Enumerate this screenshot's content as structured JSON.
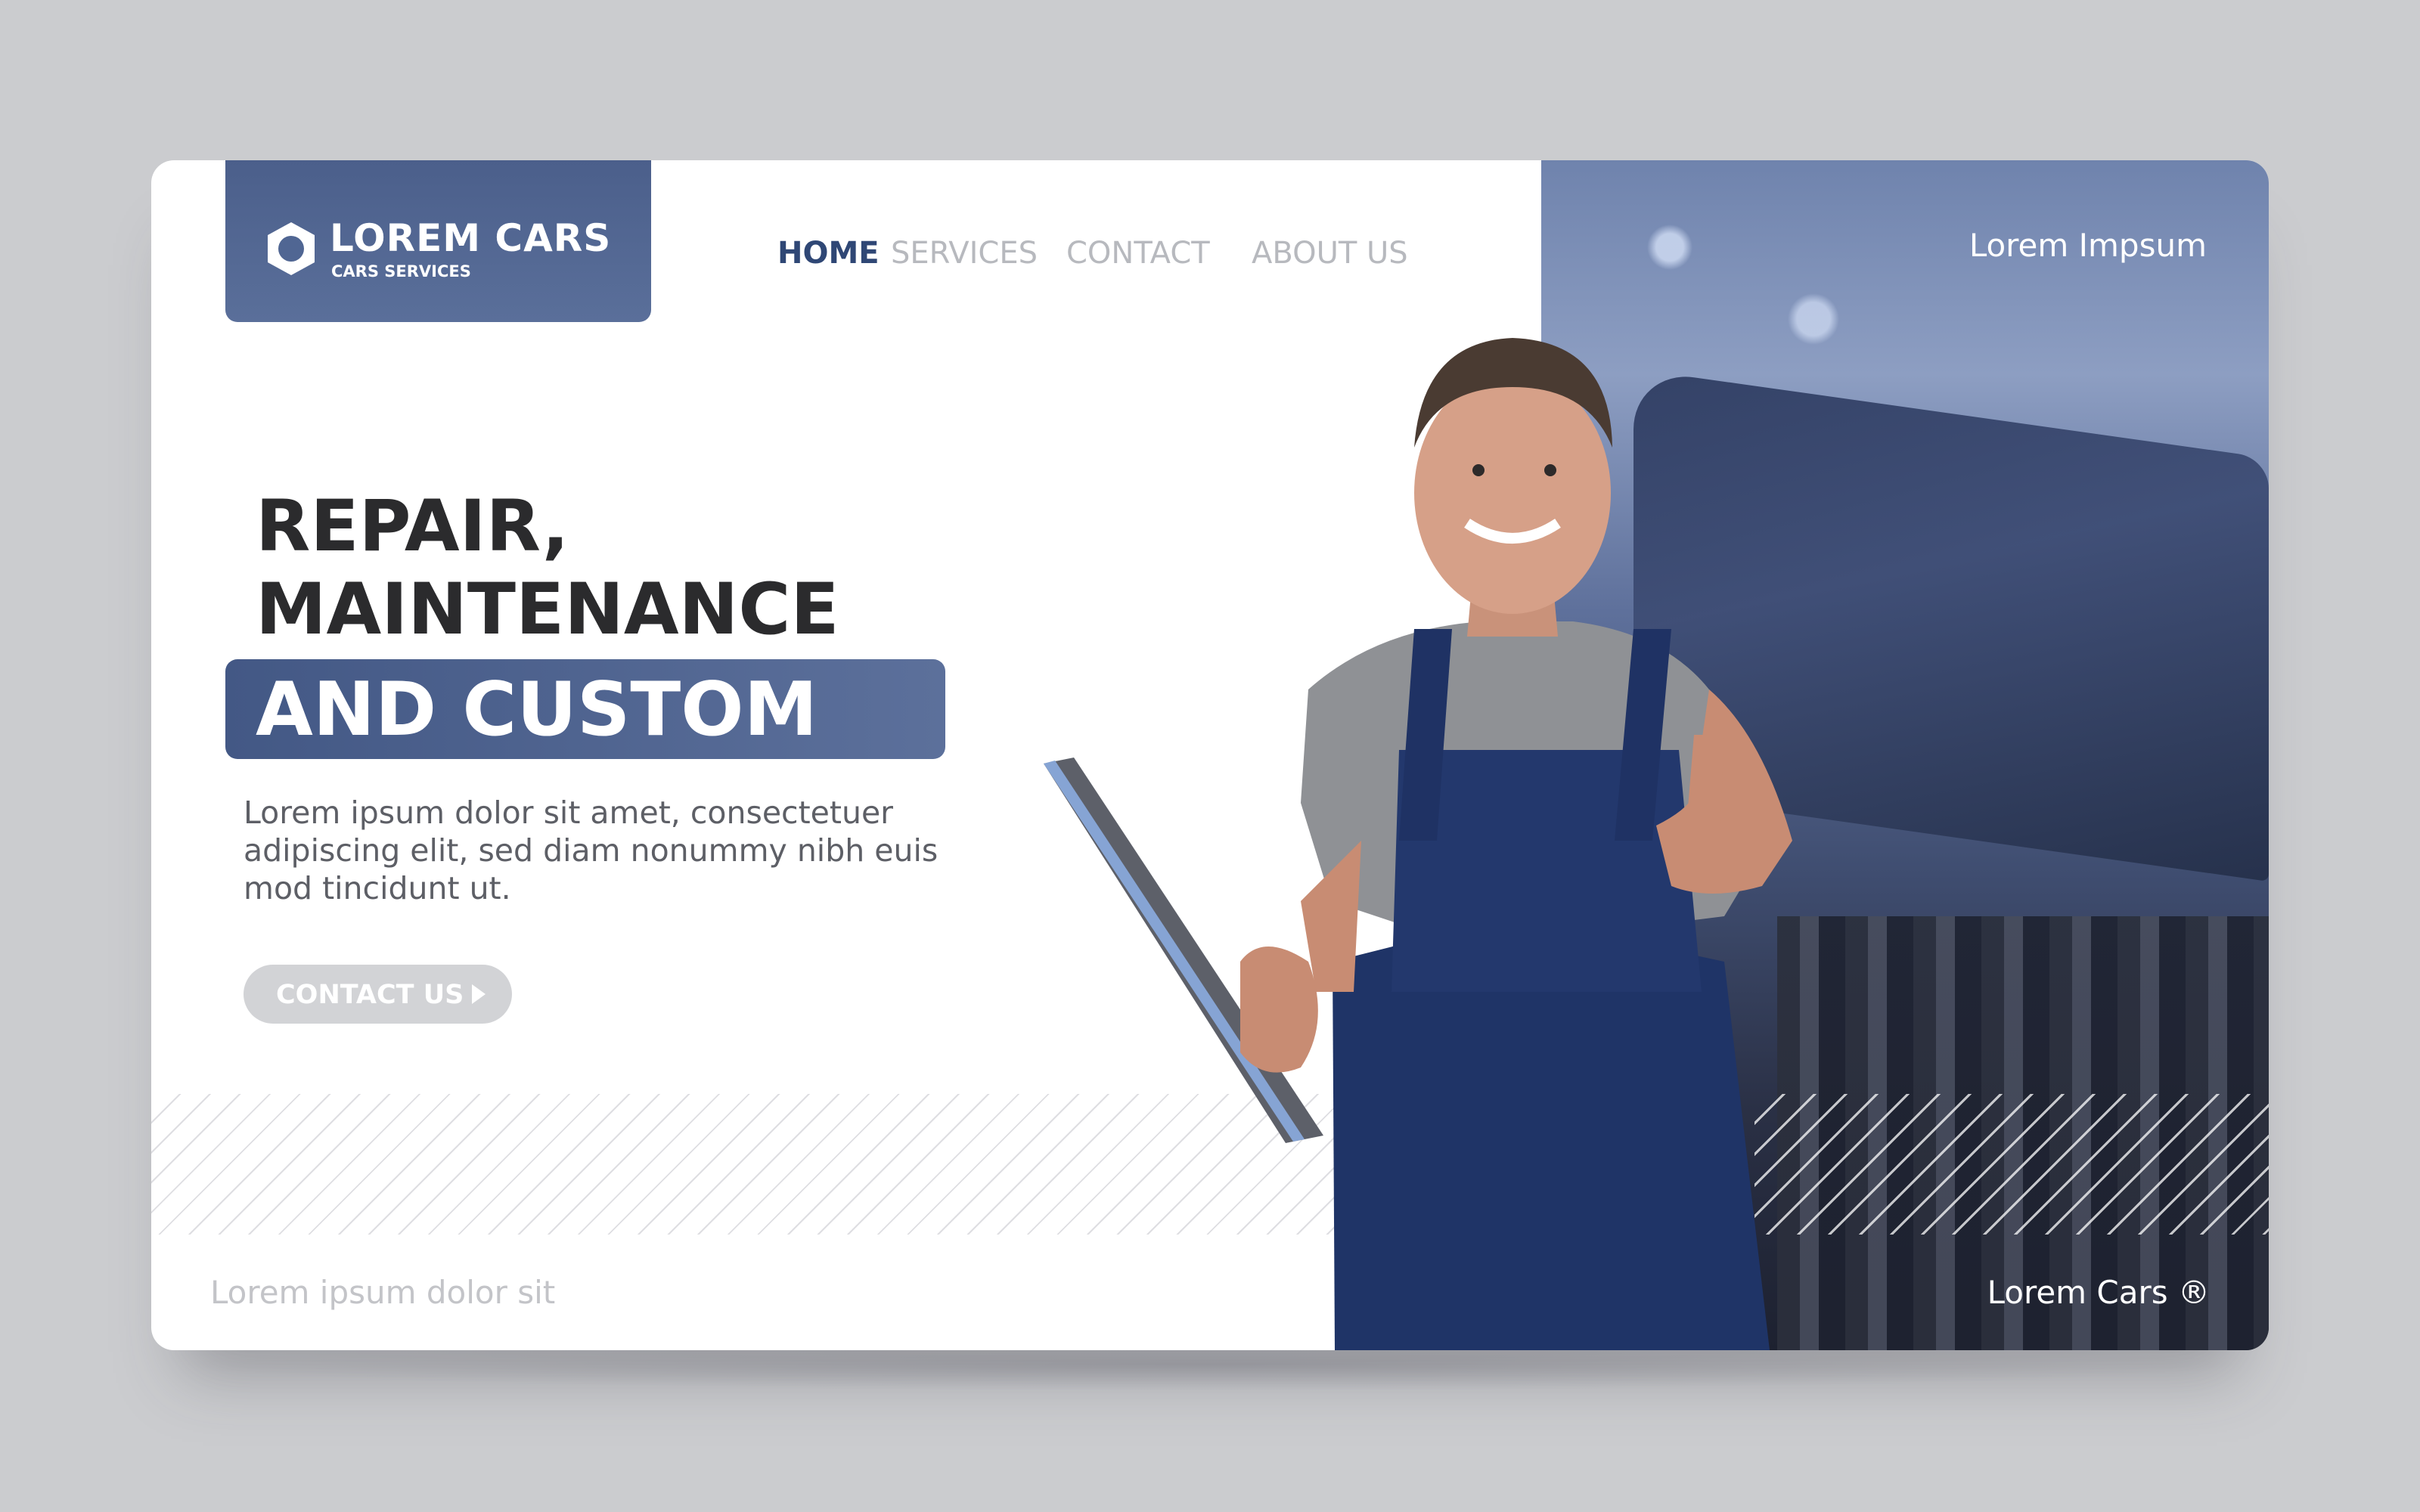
{
  "brand": {
    "name": "LOREM CARS",
    "tagline": "CARS SERVICES"
  },
  "nav": {
    "items": [
      {
        "label": "HOME",
        "active": true
      },
      {
        "label": "SERVICES",
        "active": false
      },
      {
        "label": "CONTACT",
        "active": false
      },
      {
        "label": "ABOUT US",
        "active": false
      }
    ]
  },
  "corner_top_right": "Lorem Impsum",
  "hero": {
    "line1": "REPAIR,",
    "line2": "MAINTENANCE",
    "line3": "AND CUSTOM",
    "description": "Lorem ipsum dolor sit amet, consectetuer adipiscing elit, sed diam nonummy nibh euis mod tincidunt ut.",
    "cta_label": "CONTACT US"
  },
  "footer": {
    "left": "Lorem ipsum dolor sit",
    "right": "Lorem Cars ®"
  },
  "colors": {
    "brand_blue": "#4f6591",
    "nav_active": "#2f4775",
    "nav_inactive": "#b7b9be",
    "headline": "#2b2b2d",
    "background": "#cbcccf"
  },
  "icons": {
    "logo": "hexagon-nut-icon",
    "cta": "play-arrow-icon"
  }
}
